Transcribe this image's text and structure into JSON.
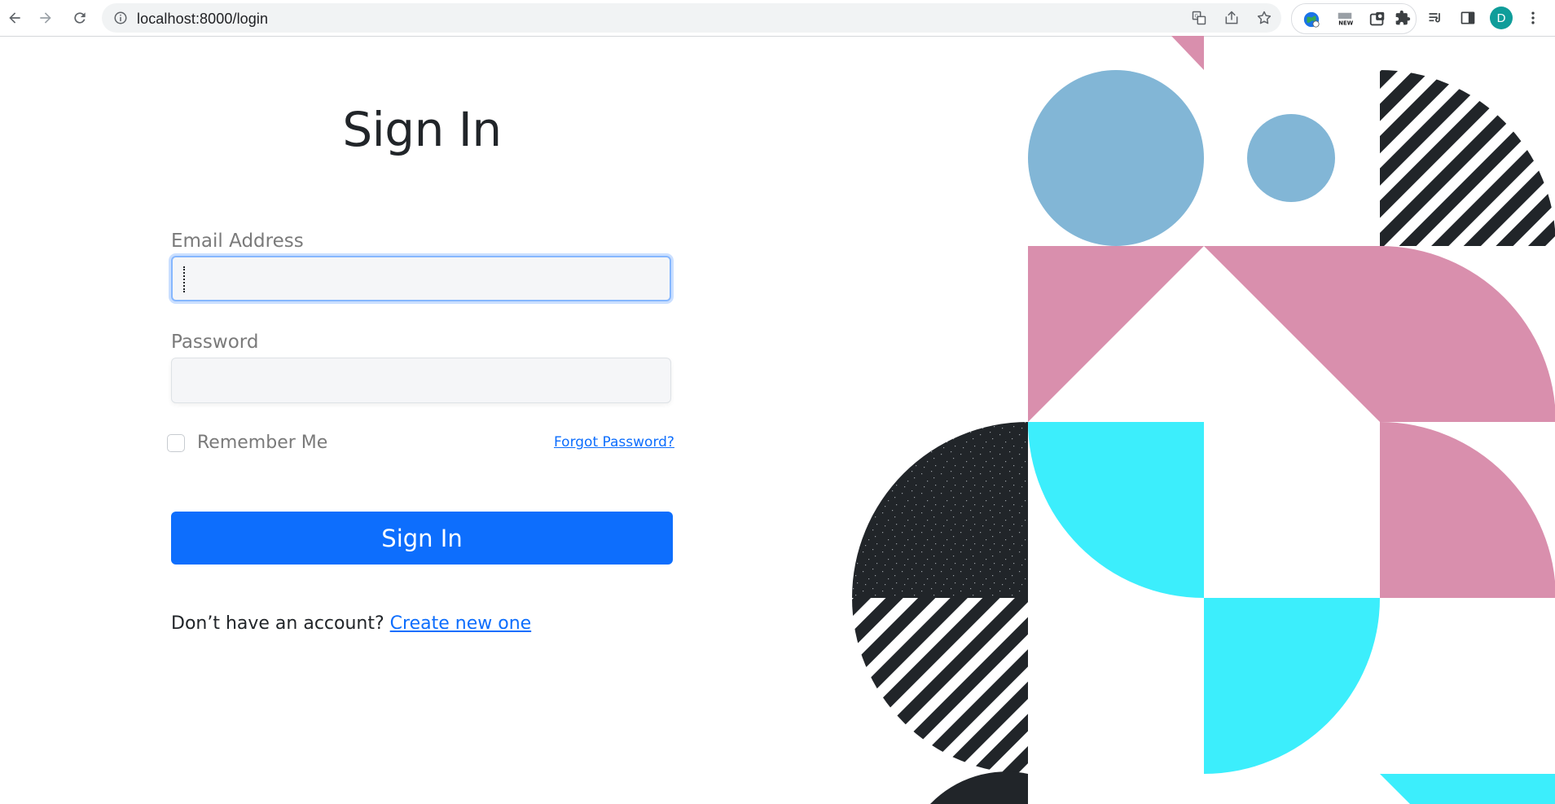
{
  "browser": {
    "url": "localhost:8000/login",
    "avatar_initial": "D",
    "icons": {
      "back": "arrow-left-icon",
      "forward": "arrow-right-icon",
      "reload": "reload-icon",
      "site_info": "info-icon",
      "translate": "translate-icon",
      "share": "share-icon",
      "bookmark": "star-icon",
      "extensions": [
        "globe-extension-icon",
        "news-extension-icon",
        "tab-extension-icon"
      ],
      "puzzle": "puzzle-extensions-icon",
      "reading_list": "reading-list-icon",
      "side_panel": "side-panel-icon",
      "menu": "more-vertical-icon"
    }
  },
  "form": {
    "title": "Sign In",
    "email_label": "Email Address",
    "email_value": "",
    "password_label": "Password",
    "password_value": "",
    "remember_label": "Remember Me",
    "remember_checked": false,
    "forgot_link": "Forgot Password?",
    "submit_label": "Sign In",
    "signup_prompt": "Don’t have an account?",
    "signup_link": "Create new one"
  },
  "colors": {
    "primary": "#0d6efd",
    "art_blue": "#82b6d6",
    "art_pink": "#d98fad",
    "art_cyan": "#3ceefc",
    "art_dark": "#212529"
  }
}
